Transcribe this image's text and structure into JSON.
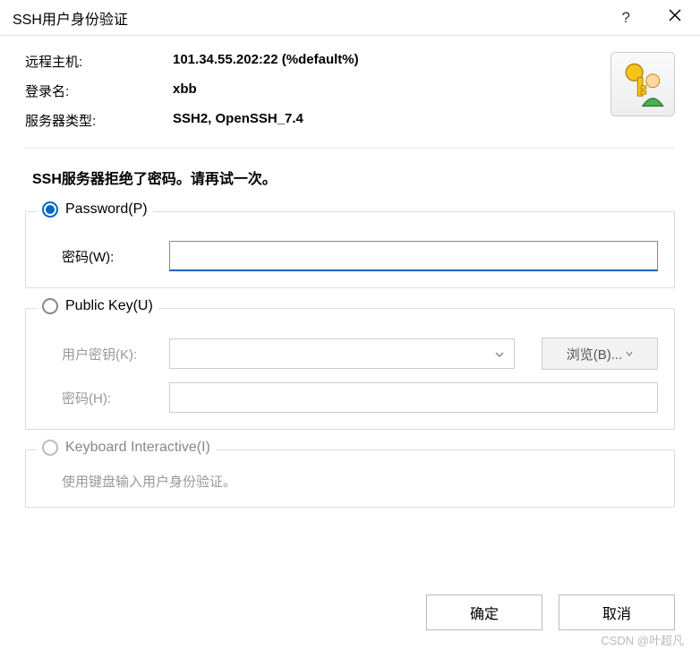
{
  "titlebar": {
    "title": "SSH用户身份验证",
    "help": "?",
    "close": "✕"
  },
  "info": {
    "remote_host_label": "远程主机:",
    "remote_host_value": "101.34.55.202:22 (%default%)",
    "login_label": "登录名:",
    "login_value": "xbb",
    "server_type_label": "服务器类型:",
    "server_type_value": "SSH2, OpenSSH_7.4"
  },
  "error_message": "SSH服务器拒绝了密码。请再试一次。",
  "password_group": {
    "legend": "Password(P)",
    "password_label": "密码(W):",
    "password_value": ""
  },
  "publickey_group": {
    "legend": "Public Key(U)",
    "userkey_label": "用户密钥(K):",
    "userkey_value": "",
    "browse_label": "浏览(B)...",
    "password_label": "密码(H):",
    "password_value": ""
  },
  "keyboard_group": {
    "legend": "Keyboard Interactive(I)",
    "hint": "使用键盘输入用户身份验证。"
  },
  "buttons": {
    "ok": "确定",
    "cancel": "取消"
  },
  "watermark": "CSDN @叶超凡"
}
